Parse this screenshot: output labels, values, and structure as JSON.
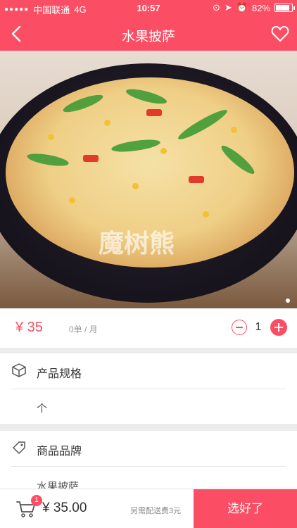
{
  "status": {
    "carrier": "中国联通",
    "network": "4G",
    "time": "10:57",
    "battery": "82%"
  },
  "nav": {
    "title": "水果披萨",
    "back_icon": "chevron-left-icon",
    "favorite_icon": "heart-icon"
  },
  "hero": {
    "watermark": "魔树熊"
  },
  "product": {
    "price": "¥ 35",
    "sold": "0单 / 月",
    "quantity": "1"
  },
  "spec": {
    "title": "产品规格",
    "value": "个",
    "icon": "box-icon"
  },
  "brand": {
    "title": "商品品牌",
    "value": "水果披萨",
    "icon": "tag-icon"
  },
  "cart": {
    "badge": "1",
    "total": "¥ 35.00",
    "delivery_fee": "另需配送费3元",
    "confirm": "选好了"
  },
  "colors": {
    "accent": "#fb4d63"
  }
}
